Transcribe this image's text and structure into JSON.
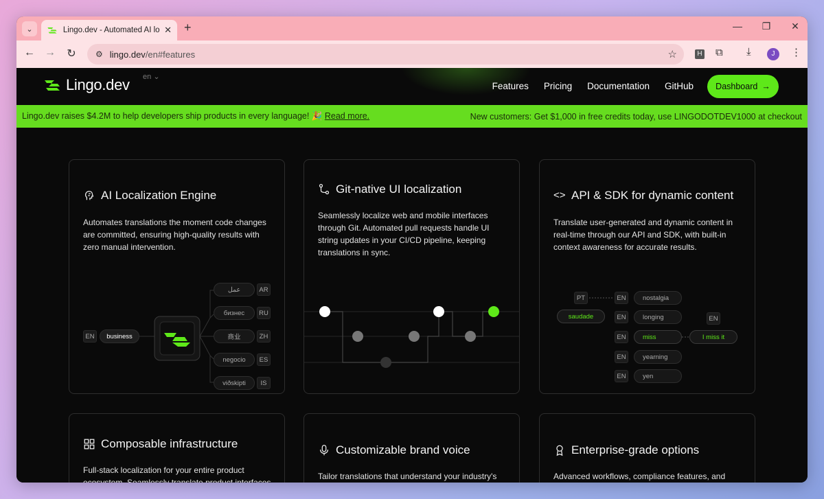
{
  "browser": {
    "tab_title": "Lingo.dev - Automated AI locali",
    "url_host": "lingo.dev",
    "url_path": "/en#features",
    "ext_h": "H",
    "avatar_letter": "J"
  },
  "nav": {
    "logo": "Lingo.dev",
    "lang": "en",
    "links": [
      "Features",
      "Pricing",
      "Documentation",
      "GitHub"
    ],
    "dashboard": "Dashboard"
  },
  "banner": {
    "left_text": "Lingo.dev raises $4.2M to help developers ship products in every language! 🎉",
    "link": "Read more.",
    "right_text": "New customers: Get $1,000 in free credits today, use LINGODOTDEV1000 at checkout"
  },
  "cards": [
    {
      "title": "AI Localization Engine",
      "desc": "Automates translations the moment code changes are committed, ensuring high-quality results with zero manual intervention.",
      "source": {
        "lang": "EN",
        "word": "business"
      },
      "targets": [
        {
          "word": "عمل",
          "lang": "AR"
        },
        {
          "word": "бизнес",
          "lang": "RU"
        },
        {
          "word": "商业",
          "lang": "ZH"
        },
        {
          "word": "negocio",
          "lang": "ES"
        },
        {
          "word": "viðskipti",
          "lang": "IS"
        }
      ]
    },
    {
      "title": "Git-native UI localization",
      "desc": "Seamlessly localize web and mobile interfaces through Git. Automated pull requests handle UI string updates in your CI/CD pipeline, keeping translations in sync."
    },
    {
      "title": "API & SDK for dynamic content",
      "desc": "Translate user-generated and dynamic content in real-time through our API and SDK, with built-in context awareness for accurate results.",
      "source": {
        "lang": "PT",
        "word": "saudade"
      },
      "candidates": [
        {
          "lang": "EN",
          "word": "nostalgia"
        },
        {
          "lang": "EN",
          "word": "longing"
        },
        {
          "lang": "EN",
          "word": "miss"
        },
        {
          "lang": "EN",
          "word": "yearning"
        },
        {
          "lang": "EN",
          "word": "yen"
        }
      ],
      "result": {
        "lang": "EN",
        "word": "I miss it"
      }
    },
    {
      "title": "Composable infrastructure",
      "desc": "Full-stack localization for your entire product ecosystem. Seamlessly translate product interfaces, marketing sites, automated emails, and dynamic"
    },
    {
      "title": "Customizable brand voice",
      "desc": "Tailor translations that understand your industry's lingo and reflect your brand's unique personality, with advanced options for scaling teams"
    },
    {
      "title": "Enterprise-grade options",
      "desc": "Advanced workflows, compliance features, and exceptional dedicated support with guaranteed SLAs and near-immediate response times"
    }
  ],
  "colors": {
    "accent": "#5ee819",
    "banner": "#66dd1f",
    "page_bg": "#0a0a0a",
    "tabbar": "#f9adb7"
  },
  "icons": {
    "back": "arrow-left-icon",
    "forward": "arrow-right-icon",
    "reload": "reload-icon",
    "star": "star-icon"
  }
}
